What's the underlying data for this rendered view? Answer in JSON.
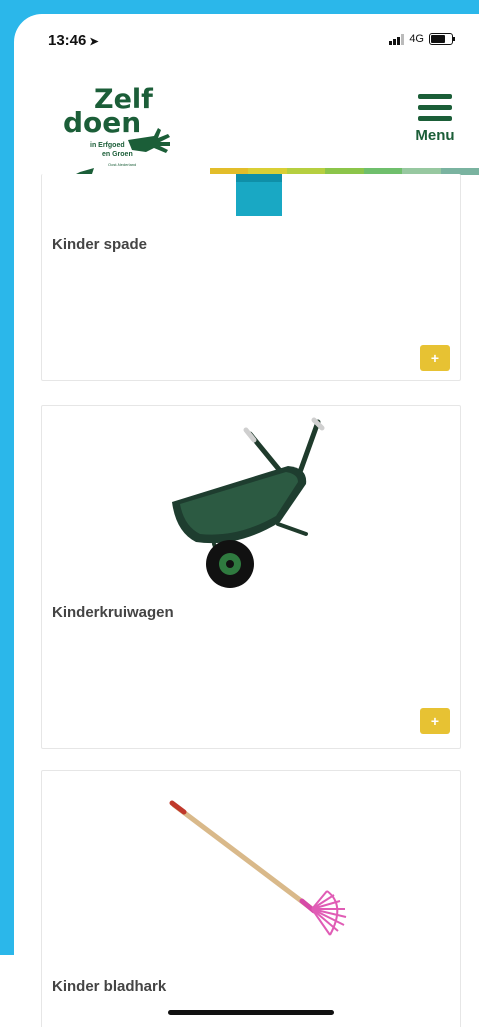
{
  "status_bar": {
    "time": "13:46",
    "location_glyph": "➤",
    "network": "4G",
    "battery_level": 0.8
  },
  "logo": {
    "word1": "Zelf",
    "word2": "doen",
    "line1": "in Erfgoed",
    "line2": "en Groen",
    "line3": "Oost-Nederland"
  },
  "header": {
    "menu_label": "Menu"
  },
  "colors": {
    "brand_green": "#1b5e38",
    "accent_yellow": "#e7c233",
    "stripe": [
      "#e2bd2a",
      "#d9cf35",
      "#b6cf40",
      "#8cc54a",
      "#6fbf6c",
      "#97c8a0",
      "#7ab3a0"
    ]
  },
  "products": [
    {
      "name": "Kinder spade",
      "add_label": "+"
    },
    {
      "name": "Kinderkruiwagen",
      "add_label": "+"
    },
    {
      "name": "Kinder bladhark",
      "add_label": "+"
    }
  ],
  "icons": [
    "location-arrow-icon",
    "signal-icon",
    "battery-icon",
    "menu-icon",
    "add-icon"
  ]
}
